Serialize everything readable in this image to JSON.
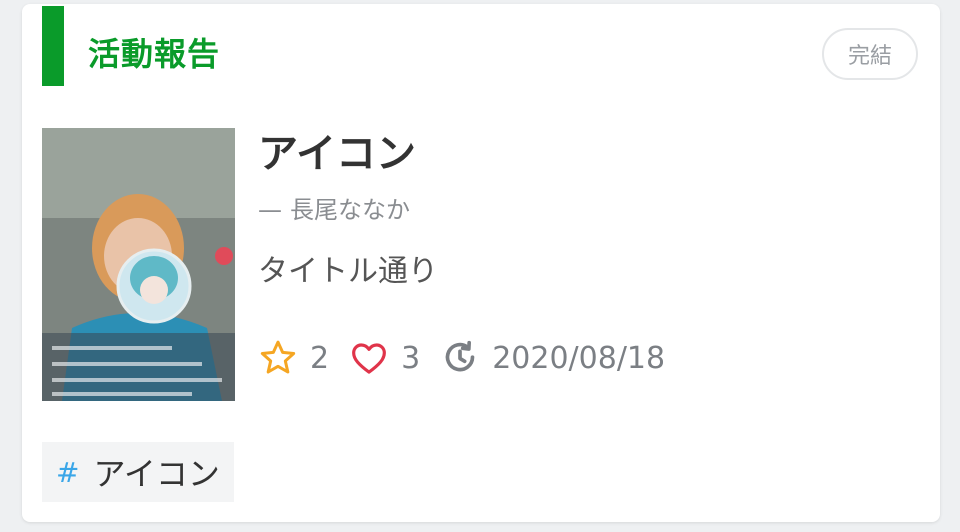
{
  "header": {
    "section_title": "活動報告",
    "status_label": "完結",
    "accent_color": "#0a9b2a"
  },
  "work": {
    "title": "アイコン",
    "author_dash": "—",
    "author": "長尾ななか",
    "description": "タイトル通り",
    "thumbnail_icon": "photo-thumbnail"
  },
  "stats": {
    "stars": "2",
    "likes": "3",
    "updated": "2020/08/18",
    "star_color": "#f5a623",
    "heart_color": "#e0344a"
  },
  "tags": [
    {
      "hash": "#",
      "label": "アイコン"
    }
  ]
}
